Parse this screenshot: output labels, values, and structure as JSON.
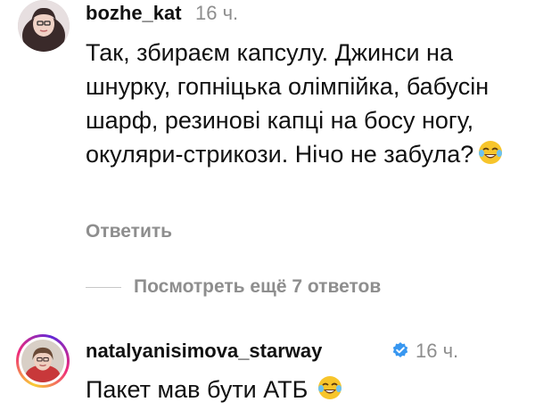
{
  "comments": [
    {
      "username": "bozhe_kat",
      "time": "16 ч.",
      "text": "Так, збираєм капсулу. Джинси на шнурку, гопніцька олімпійка, бабусін шарф, резинові капці на босу ногу, окуляри-стрикози. Нічо не забула?",
      "emoji": "face-with-tears-of-joy",
      "reply_label": "Ответить"
    },
    {
      "username": "natalyanisimova_starway",
      "time": "16 ч.",
      "verified": true,
      "text": "Пакет мав бути АТБ",
      "emoji": "face-with-tears-of-joy"
    }
  ],
  "view_replies_label": "Посмотреть ещё 7 ответов",
  "colors": {
    "text": "#111111",
    "muted": "#8e8e8e",
    "verified": "#3897f0"
  }
}
